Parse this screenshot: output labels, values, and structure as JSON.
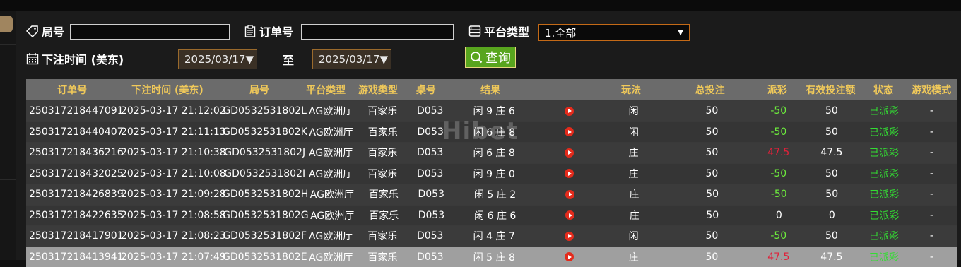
{
  "filters": {
    "round_label": "局号",
    "round_value": "",
    "order_label": "订单号",
    "order_value": "",
    "platform_label": "平台类型",
    "platform_selected": "1.全部",
    "bet_time_label": "下注时间 (美东)",
    "date_from": "2025/03/17▼",
    "to_label": "至",
    "date_to": "2025/03/17▼",
    "query_label": "查询"
  },
  "table": {
    "headers": [
      "订单号",
      "下注时间 (美东)",
      "局号",
      "平台类型",
      "游戏类型",
      "桌号",
      "结果",
      "",
      "玩法",
      "总投注",
      "派彩",
      "有效投注额",
      "状态",
      "游戏模式"
    ],
    "rows": [
      {
        "order": "250317218447091",
        "time": "2025-03-17 21:12:02",
        "round": "GD0532531802L",
        "platform": "AG欧洲厅",
        "game": "百家乐",
        "table": "D053",
        "result": "闲 9 庄 6",
        "play": "闲",
        "bet": "50",
        "payout": "-50",
        "payout_type": "neg",
        "valid": "50",
        "status": "已派彩",
        "mode": "-"
      },
      {
        "order": "250317218440407",
        "time": "2025-03-17 21:11:13",
        "round": "GD0532531802K",
        "platform": "AG欧洲厅",
        "game": "百家乐",
        "table": "D053",
        "result": "闲 6 庄 8",
        "play": "闲",
        "bet": "50",
        "payout": "-50",
        "payout_type": "neg",
        "valid": "50",
        "status": "已派彩",
        "mode": "-"
      },
      {
        "order": "250317218436216",
        "time": "2025-03-17 21:10:38",
        "round": "GD0532531802J",
        "platform": "AG欧洲厅",
        "game": "百家乐",
        "table": "D053",
        "result": "闲 6 庄 8",
        "play": "庄",
        "bet": "50",
        "payout": "47.5",
        "payout_type": "pos",
        "valid": "47.5",
        "status": "已派彩",
        "mode": "-"
      },
      {
        "order": "250317218432025",
        "time": "2025-03-17 21:10:08",
        "round": "GD0532531802I",
        "platform": "AG欧洲厅",
        "game": "百家乐",
        "table": "D053",
        "result": "闲 9 庄 0",
        "play": "庄",
        "bet": "50",
        "payout": "-50",
        "payout_type": "neg",
        "valid": "50",
        "status": "已派彩",
        "mode": "-"
      },
      {
        "order": "250317218426839",
        "time": "2025-03-17 21:09:28",
        "round": "GD0532531802H",
        "platform": "AG欧洲厅",
        "game": "百家乐",
        "table": "D053",
        "result": "闲 5 庄 2",
        "play": "庄",
        "bet": "50",
        "payout": "-50",
        "payout_type": "neg",
        "valid": "50",
        "status": "已派彩",
        "mode": "-"
      },
      {
        "order": "250317218422635",
        "time": "2025-03-17 21:08:58",
        "round": "GD0532531802G",
        "platform": "AG欧洲厅",
        "game": "百家乐",
        "table": "D053",
        "result": "闲 6 庄 6",
        "play": "庄",
        "bet": "50",
        "payout": "0",
        "payout_type": "zero",
        "valid": "0",
        "status": "已派彩",
        "mode": "-"
      },
      {
        "order": "250317218417901",
        "time": "2025-03-17 21:08:23",
        "round": "GD0532531802F",
        "platform": "AG欧洲厅",
        "game": "百家乐",
        "table": "D053",
        "result": "闲 4 庄 7",
        "play": "闲",
        "bet": "50",
        "payout": "-50",
        "payout_type": "neg",
        "valid": "50",
        "status": "已派彩",
        "mode": "-"
      },
      {
        "order": "250317218413941",
        "time": "2025-03-17 21:07:49",
        "round": "GD0532531802E",
        "platform": "AG欧洲厅",
        "game": "百家乐",
        "table": "D053",
        "result": "闲 5 庄 8",
        "play": "庄",
        "bet": "50",
        "payout": "47.5",
        "payout_type": "pos",
        "valid": "47.5",
        "status": "已派彩",
        "mode": "-"
      }
    ]
  },
  "watermark": "Hibet",
  "colors": {
    "header_text": "#f0c95a",
    "negative_payout": "#6dee3c",
    "positive_payout": "#e0213a",
    "status": "#33dd33",
    "query_button": "#58a51e"
  }
}
